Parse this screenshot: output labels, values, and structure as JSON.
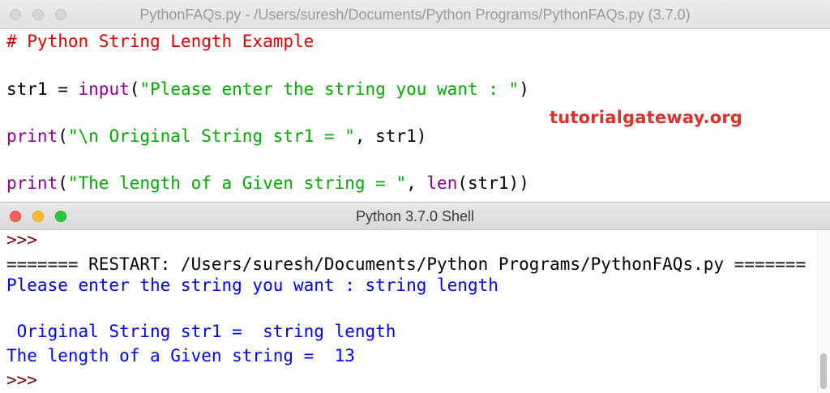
{
  "editor": {
    "title": "PythonFAQs.py - /Users/suresh/Documents/Python Programs/PythonFAQs.py (3.7.0)",
    "lines": {
      "comment": "# Python String Length Example",
      "l2_var": "str1 = ",
      "l2_fn": "input",
      "l2_open": "(",
      "l2_str": "\"Please enter the string you want : \"",
      "l2_close": ")",
      "l3_fn": "print",
      "l3_open": "(",
      "l3_str": "\"\\n Original String str1 = \"",
      "l3_rest": ", str1)",
      "l4_fn": "print",
      "l4_open": "(",
      "l4_str": "\"The length of a Given string = \"",
      "l4_mid": ", ",
      "l4_fn2": "len",
      "l4_rest": "(str1))"
    },
    "watermark": "tutorialgateway.org"
  },
  "shell": {
    "title": "Python 3.7.0 Shell",
    "prompt": ">>>",
    "restart": "======= RESTART: /Users/suresh/Documents/Python Programs/PythonFAQs.py =======",
    "input_line": "Please enter the string you want : string length",
    "output_original": " Original String str1 =  string length",
    "output_length": "The length of a Given string =  13",
    "prompt_end": ">>>"
  },
  "colors": {
    "comment": "#dd0000",
    "builtin": "#900090",
    "string": "#00aa00",
    "prompt": "#770000",
    "output": "#0000ff",
    "watermark": "#d6342c"
  }
}
